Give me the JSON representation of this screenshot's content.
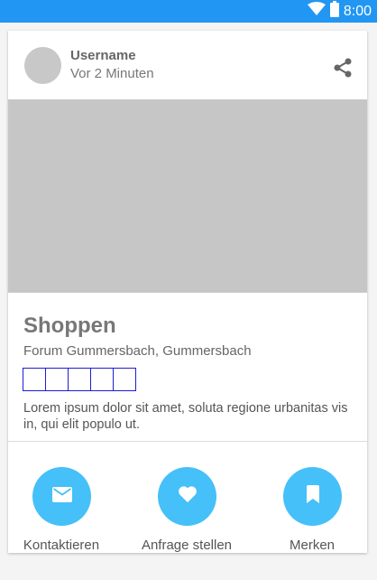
{
  "status_bar": {
    "time": "8:00",
    "color": "#2196f3",
    "icons": [
      "wifi-icon",
      "battery-icon"
    ]
  },
  "post": {
    "username": "Username",
    "timestamp": "Vor 2 Minuten",
    "share_icon": "share-icon",
    "title": "Shoppen",
    "location": "Forum Gummersbach, Gummersbach",
    "rating_boxes": 5,
    "description": "Lorem ipsum dolor sit amet, soluta regione urbanitas vis in, qui elit populo ut."
  },
  "actions": [
    {
      "label": "Kontaktieren",
      "icon": "mail-icon"
    },
    {
      "label": "Anfrage stellen",
      "icon": "heart-icon"
    },
    {
      "label": "Merken",
      "icon": "bookmark-icon"
    }
  ],
  "colors": {
    "accent": "#45c0f8",
    "rating_border": "#1d1dd4",
    "placeholder": "#c6c6c6"
  }
}
